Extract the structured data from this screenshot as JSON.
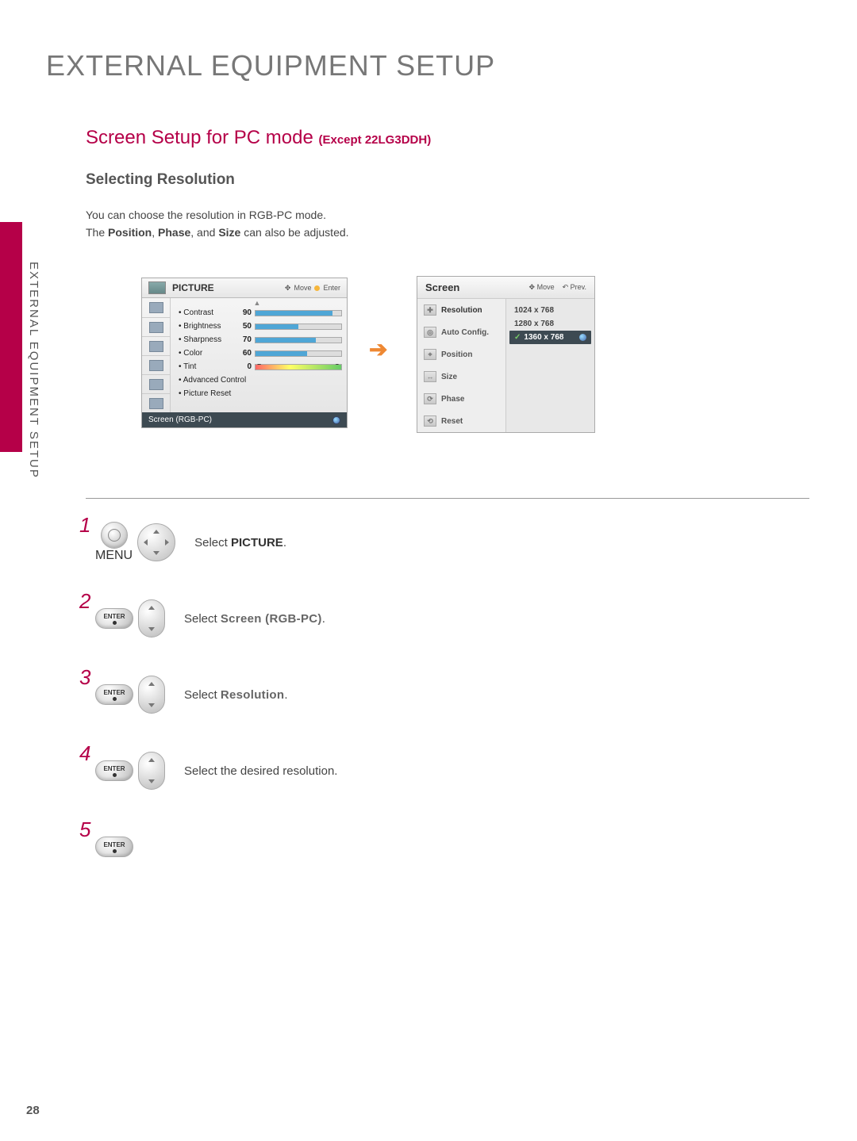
{
  "page": {
    "number": "28",
    "side_label": "EXTERNAL EQUIPMENT SETUP",
    "main_title": "EXTERNAL EQUIPMENT SETUP",
    "section_title": "Screen Setup for PC mode ",
    "section_except": "(Except 22LG3DDH)",
    "sub_title": "Selecting Resolution",
    "desc_line1": "You can choose the resolution in RGB-PC mode.",
    "desc_line2_pre": "The ",
    "desc_line2_b1": "Position",
    "desc_line2_mid1": ", ",
    "desc_line2_b2": "Phase",
    "desc_line2_mid2": ", and ",
    "desc_line2_b3": "Size",
    "desc_line2_post": " can also be adjusted."
  },
  "picture_osd": {
    "title": "PICTURE",
    "hint_move": "Move",
    "hint_enter": "Enter",
    "up_arrow": "▲",
    "rows": [
      {
        "label": "• Contrast",
        "value": "90",
        "fill": 90
      },
      {
        "label": "• Brightness",
        "value": "50",
        "fill": 50
      },
      {
        "label": "• Sharpness",
        "value": "70",
        "fill": 70
      },
      {
        "label": "• Color",
        "value": "60",
        "fill": 60
      },
      {
        "label": "• Tint",
        "value": "0",
        "fill": 50,
        "tint": true,
        "left": "R",
        "right": "G"
      }
    ],
    "plain_rows": [
      "• Advanced Control",
      "• Picture Reset"
    ],
    "footer": "Screen (RGB-PC)"
  },
  "screen_osd": {
    "title": "Screen",
    "hint_move": "Move",
    "hint_prev": "Prev.",
    "items": [
      "Resolution",
      "Auto Config.",
      "Position",
      "Size",
      "Phase",
      "Reset"
    ],
    "resolutions": [
      {
        "label": "1024 x 768",
        "selected": false
      },
      {
        "label": "1280 x 768",
        "selected": false
      },
      {
        "label": "1360 x 768",
        "selected": true
      }
    ]
  },
  "steps": [
    {
      "num": "1",
      "kind": "menu",
      "text_pre": "Select ",
      "text_bold": "PICTURE",
      "text_post": "."
    },
    {
      "num": "2",
      "kind": "enter_ud",
      "text_pre": "Select ",
      "text_bold": "Screen  (RGB-PC)",
      "text_post": "."
    },
    {
      "num": "3",
      "kind": "enter_ud",
      "text_pre": "Select ",
      "text_bold": "Resolution",
      "text_post": "."
    },
    {
      "num": "4",
      "kind": "enter_ud",
      "text_pre": "Select the desired resolution.",
      "text_bold": "",
      "text_post": ""
    },
    {
      "num": "5",
      "kind": "enter_only",
      "text_pre": "",
      "text_bold": "",
      "text_post": ""
    }
  ],
  "btn_labels": {
    "menu": "MENU",
    "enter": "ENTER"
  }
}
